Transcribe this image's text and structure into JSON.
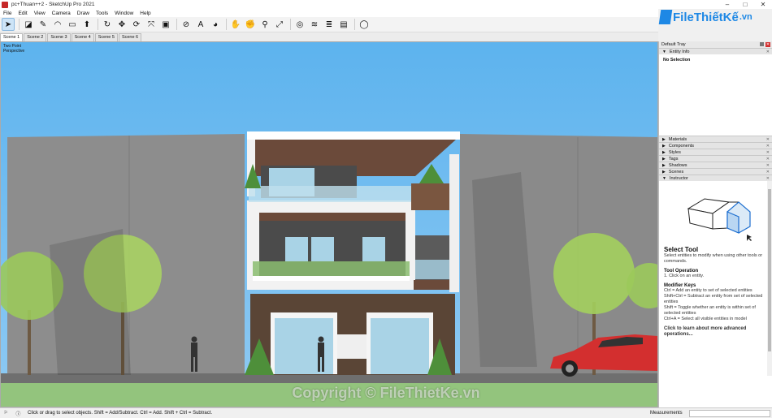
{
  "window": {
    "title": "pc+Thuan++2 - SketchUp Pro 2021",
    "controls": [
      "–",
      "□",
      "✕"
    ]
  },
  "menu": [
    "File",
    "Edit",
    "View",
    "Camera",
    "Draw",
    "Tools",
    "Window",
    "Help"
  ],
  "toolbar": {
    "tools": [
      {
        "icon": "select-arrow-icon",
        "glyph": "➤",
        "active": true
      },
      {
        "icon": "eraser-icon",
        "glyph": "◪"
      },
      {
        "icon": "pencil-line-icon",
        "glyph": "✎"
      },
      {
        "icon": "arc-icon",
        "glyph": "◠"
      },
      {
        "icon": "rectangle-icon",
        "glyph": "▭"
      },
      {
        "icon": "push-pull-icon",
        "glyph": "⬆"
      },
      {
        "icon": "follow-me-icon",
        "glyph": "↻"
      },
      {
        "icon": "move-icon",
        "glyph": "✥"
      },
      {
        "icon": "rotate-icon",
        "glyph": "⟳"
      },
      {
        "icon": "scale-icon",
        "glyph": "⤧"
      },
      {
        "icon": "offset-icon",
        "glyph": "▣"
      },
      {
        "icon": "tape-measure-icon",
        "glyph": "⊘"
      },
      {
        "icon": "text-icon",
        "glyph": "A"
      },
      {
        "icon": "paint-bucket-icon",
        "glyph": "◕"
      },
      {
        "icon": "orbit-icon",
        "glyph": "✋"
      },
      {
        "icon": "pan-icon",
        "glyph": "✊"
      },
      {
        "icon": "zoom-icon",
        "glyph": "⚲"
      },
      {
        "icon": "zoom-extents-icon",
        "glyph": "⤢"
      },
      {
        "icon": "3d-warehouse-icon",
        "glyph": "◎"
      },
      {
        "icon": "extension-warehouse-icon",
        "glyph": "≋"
      },
      {
        "icon": "layout-icon",
        "glyph": "≣"
      },
      {
        "icon": "extension-manager-icon",
        "glyph": "▤"
      },
      {
        "icon": "account-icon",
        "glyph": "◯"
      }
    ]
  },
  "scenes": [
    "Scene 1",
    "Scene 2",
    "Scene 3",
    "Scene 4",
    "Scene 5",
    "Scene 6"
  ],
  "viewport": {
    "label_line1": "Two Point",
    "label_line2": "Perspective"
  },
  "logo": {
    "name": "FileThiếtKế",
    "tld": ".vn"
  },
  "tray": {
    "title": "Default Tray",
    "entity_info": {
      "label": "Entity Info",
      "state": "No Selection"
    },
    "panels": [
      "Materials",
      "Components",
      "Styles",
      "Tags",
      "Shadows",
      "Scenes",
      "Instructor"
    ],
    "instructor": {
      "title": "Select Tool",
      "subtitle": "Select entities to modify when using other tools or commands.",
      "op_heading": "Tool Operation",
      "op_text": "1. Click on an entity.",
      "mod_heading": "Modifier Keys",
      "mod_text_1": "Ctrl = Add an entity to set of selected entities",
      "mod_text_2": "Shift+Ctrl = Subtract an entity from set of selected entities",
      "mod_text_3": "Shift = Toggle whether an entity is within set of selected entities",
      "mod_text_4": "Ctrl+A = Select all visible entities in model",
      "more": "Click to learn about more advanced operations..."
    }
  },
  "status": {
    "hint": "Click or drag to select objects. Shift = Add/Subtract. Ctrl = Add. Shift + Ctrl = Subtract.",
    "measurements_label": "Measurements"
  },
  "watermark": "Copyright © FileThietKe.vn",
  "colors": {
    "sky": "#63b8ef",
    "wall_gray": "#8f8f8f",
    "building_white": "#f2f2f2",
    "wood": "#6b4a3a",
    "glass": "#a9d3e6",
    "grass": "#93c47d",
    "car_red": "#d32f2f",
    "logo_blue": "#1e88e5"
  }
}
